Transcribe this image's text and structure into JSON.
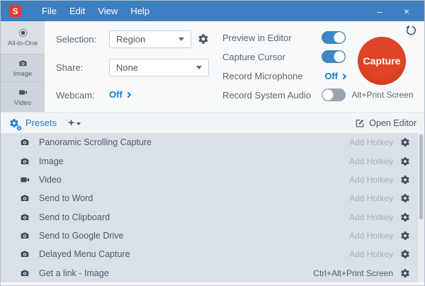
{
  "titlebar": {
    "app_initial": "S",
    "menus": [
      "File",
      "Edit",
      "View",
      "Help"
    ],
    "minimize": "–",
    "close": "×"
  },
  "sidebar": {
    "tabs": [
      {
        "label": "All-in-One",
        "icon": "all-in-one-icon",
        "selected": true
      },
      {
        "label": "Image",
        "icon": "camera-icon",
        "selected": false
      },
      {
        "label": "Video",
        "icon": "video-icon",
        "selected": false
      }
    ]
  },
  "controls": {
    "selection_label": "Selection:",
    "selection_value": "Region",
    "share_label": "Share:",
    "share_value": "None",
    "webcam_label": "Webcam:",
    "webcam_value": "Off"
  },
  "options": [
    {
      "label": "Preview in Editor",
      "type": "toggle",
      "state": "on"
    },
    {
      "label": "Capture Cursor",
      "type": "toggle",
      "state": "on"
    },
    {
      "label": "Record Microphone",
      "type": "link",
      "value": "Off"
    },
    {
      "label": "Record System Audio",
      "type": "toggle",
      "state": "off"
    }
  ],
  "capture": {
    "button_label": "Capture",
    "hotkey": "Alt+Print Screen"
  },
  "presets_bar": {
    "title": "Presets",
    "add_label": "+",
    "open_editor_label": "Open Editor"
  },
  "presets": {
    "rows": [
      {
        "icon": "camera-icon",
        "label": "Panoramic Scrolling Capture",
        "hotkey": "Add Hotkey",
        "assigned": false
      },
      {
        "icon": "camera-icon",
        "label": "Image",
        "hotkey": "Add Hotkey",
        "assigned": false
      },
      {
        "icon": "video-icon",
        "label": "Video",
        "hotkey": "Add Hotkey",
        "assigned": false
      },
      {
        "icon": "camera-icon",
        "label": "Send to Word",
        "hotkey": "Add Hotkey",
        "assigned": false
      },
      {
        "icon": "camera-icon",
        "label": "Send to Clipboard",
        "hotkey": "Add Hotkey",
        "assigned": false
      },
      {
        "icon": "camera-icon",
        "label": "Send to Google Drive",
        "hotkey": "Add Hotkey",
        "assigned": false
      },
      {
        "icon": "camera-icon",
        "label": "Delayed Menu Capture",
        "hotkey": "Add Hotkey",
        "assigned": false
      },
      {
        "icon": "camera-icon",
        "label": "Get a link - Image",
        "hotkey": "Ctrl+Alt+Print Screen",
        "assigned": true
      }
    ]
  },
  "colors": {
    "titlebar_blue": "#3e7fc1",
    "logo_red": "#e23c2c",
    "capture_red": "#d63b20",
    "toggle_on_blue": "#3e86c6",
    "toggle_off_gray": "#99a3ac",
    "link_blue": "#1a7cd0",
    "presets_blue": "#2879c0",
    "list_bg": "#d9e0e7"
  }
}
